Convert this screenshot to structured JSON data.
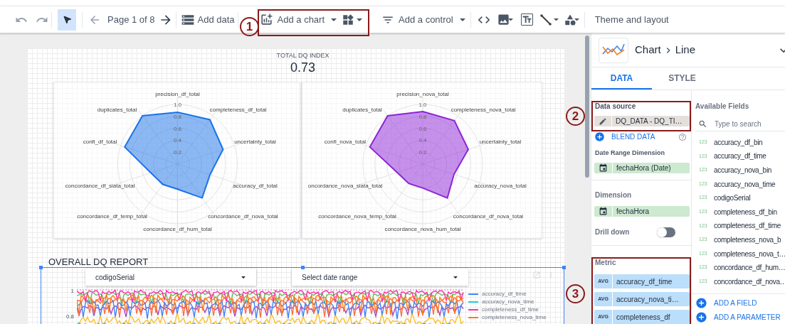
{
  "toolbar": {
    "select_tool": {
      "selected": true
    },
    "page_indicator": "Page 1 of 8",
    "add_data": "Add data",
    "add_chart": "Add a chart",
    "add_control": "Add a control",
    "theme": "Theme and layout"
  },
  "annotations": [
    {
      "label": "1"
    },
    {
      "label": "2"
    },
    {
      "label": "3"
    }
  ],
  "report": {
    "index_title": "TOTAL DQ INDEX",
    "index_value": "0.73",
    "radars": [
      {
        "color": "#1a73e8",
        "ticks": [
          "1.0",
          "0.8",
          "0.6",
          "0.4",
          "0.2"
        ],
        "axes": [
          "precision_df_total",
          "duplicates_total",
          "completeness_df_total",
          "confi_df_total",
          "uncertainty_total",
          "concordance_df_siata_total",
          "accuracy_df_total",
          "concordance_df_temp_total",
          "concordance_df_nova_total",
          "concordance_df_hum_total"
        ]
      },
      {
        "color": "#8e24d8",
        "ticks": [
          "1.0",
          "0.8",
          "0.6",
          "0.4",
          "0.2"
        ],
        "axes": [
          "precision_nova_total",
          "duplicates_total",
          "completeness_nova_total",
          "confi_nova_total",
          "uncertainty_total",
          "oncordance_nova_siata_total",
          "accuracy_nova_total",
          "concordance_nova_temp_total",
          "concordance_df_nova_total",
          "concordance_nova_hum_total"
        ]
      }
    ],
    "section_title": "OVERALL DQ REPORT",
    "filters": [
      {
        "label": "codigoSerial"
      },
      {
        "label": "Select date range"
      }
    ],
    "line_chart": {
      "y_ticks": [
        "1",
        "0.8"
      ],
      "legend": [
        {
          "name": "accuracy_df_time",
          "color": "#4285f4"
        },
        {
          "name": "accuracy_nova_time",
          "color": "#26c6da"
        },
        {
          "name": "completeness_df_time",
          "color": "#ff2ea6"
        },
        {
          "name": "completeness_nova_time",
          "color": "#ff7a1a"
        }
      ]
    }
  },
  "panel": {
    "chart_type": "Chart",
    "chart_subtype": "Line",
    "tabs": [
      {
        "label": "DATA",
        "selected": true
      },
      {
        "label": "STYLE",
        "selected": false
      }
    ],
    "data_source_label": "Data source",
    "data_source": "DQ_DATA - DQ_TI…",
    "blend": "BLEND DATA",
    "date_range_label": "Date Range Dimension",
    "date_range": "fechaHora (Date)",
    "dimension_label": "Dimension",
    "dimension": "fechaHora",
    "drill_down": {
      "label": "Drill down",
      "on": false
    },
    "metric_label": "Metric",
    "metrics": [
      {
        "agg": "AVG",
        "field": "accuracy_df_time"
      },
      {
        "agg": "AVG",
        "field": "accuracy_nova_ti…"
      },
      {
        "agg": "AVG",
        "field": "completeness_df"
      }
    ],
    "available_label": "Available Fields",
    "search_placeholder": "Type to search",
    "fields": [
      {
        "type": "123",
        "name": "accuracy_df_bin"
      },
      {
        "type": "123",
        "name": "accuracy_df_time"
      },
      {
        "type": "123",
        "name": "accuracy_nova_bin"
      },
      {
        "type": "123",
        "name": "accuracy_nova_time"
      },
      {
        "type": "123",
        "name": "codigoSerial"
      },
      {
        "type": "123",
        "name": "completeness_df_bin"
      },
      {
        "type": "123",
        "name": "completeness_df_time"
      },
      {
        "type": "123",
        "name": "completeness_nova_b"
      },
      {
        "type": "123",
        "name": "completeness_nova_t…"
      },
      {
        "type": "123",
        "name": "concordance_df_hum…"
      },
      {
        "type": "123",
        "name": "concordance_df_nova…"
      }
    ],
    "add_field": "ADD A FIELD",
    "add_parameter": "ADD A PARAMETER"
  }
}
